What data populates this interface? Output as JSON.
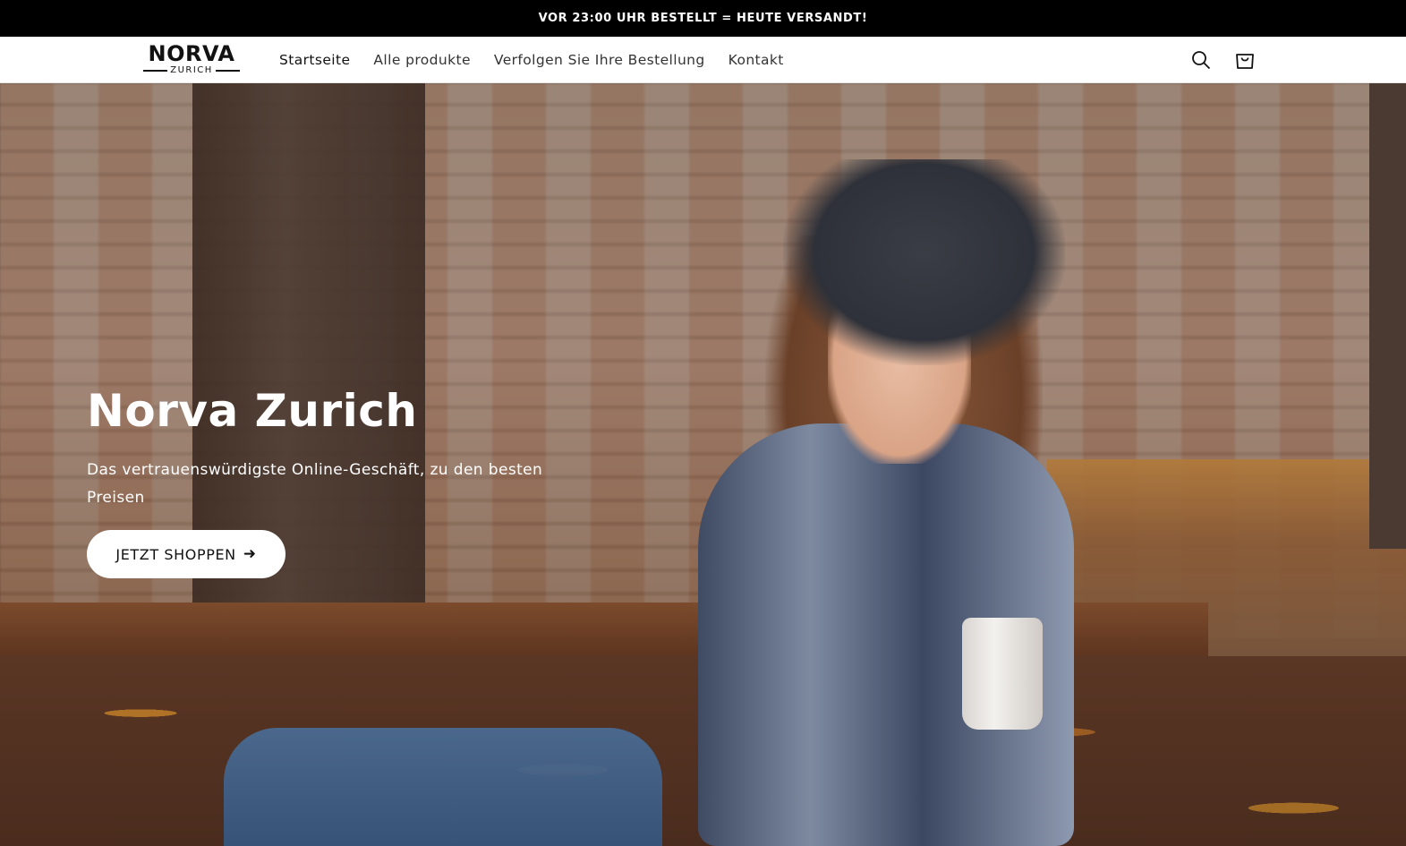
{
  "announcement": {
    "text": "VOR 23:00 UHR BESTELLT = HEUTE VERSANDT!"
  },
  "header": {
    "logo": {
      "main": "NORVA",
      "sub": "ZURICH"
    },
    "nav": [
      {
        "label": "Startseite",
        "active": true
      },
      {
        "label": "Alle produkte",
        "active": false
      },
      {
        "label": "Verfolgen Sie Ihre Bestellung",
        "active": false
      },
      {
        "label": "Kontakt",
        "active": false
      }
    ],
    "icons": {
      "search": "search-icon",
      "cart": "cart-icon"
    }
  },
  "hero": {
    "title": "Norva Zurich",
    "subtitle": "Das vertrauenswürdigste Online-Geschäft, zu den besten Preisen",
    "button_label": "JETZT SHOPPEN",
    "button_icon": "arrow-right-icon"
  },
  "colors": {
    "announcement_bg": "#000000",
    "text": "#121212",
    "hero_text": "#ffffff"
  }
}
